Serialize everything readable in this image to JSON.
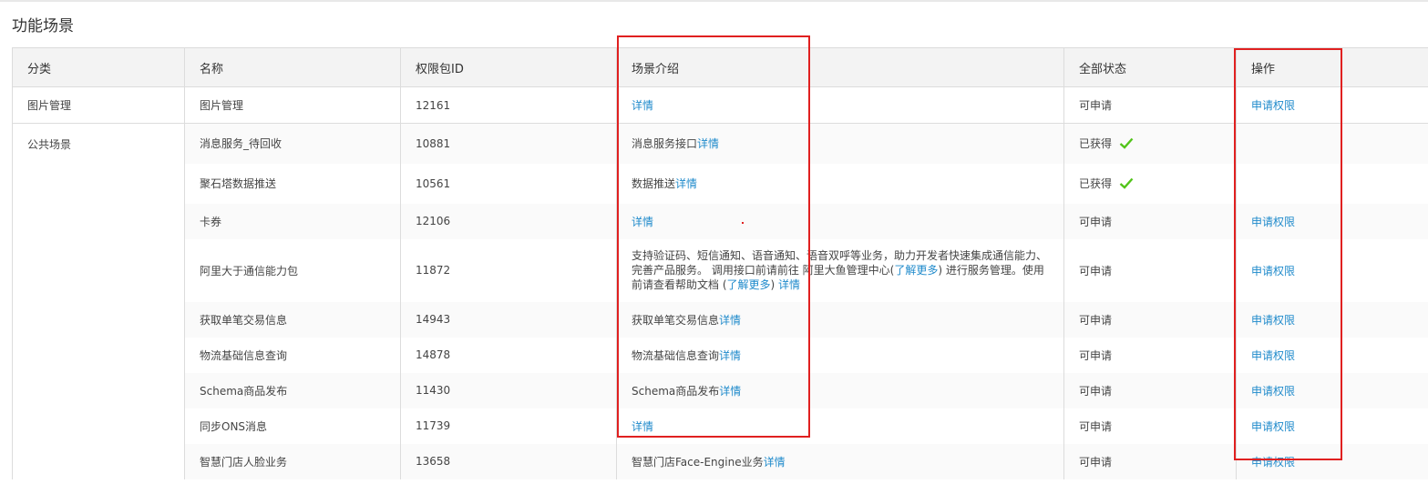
{
  "page": {
    "title": "功能场景"
  },
  "table": {
    "headers": {
      "category": "分类",
      "name": "名称",
      "package_id": "权限包ID",
      "intro": "场景介绍",
      "status": "全部状态",
      "action": "操作"
    },
    "rows": [
      {
        "category": "图片管理",
        "name": "图片管理",
        "id": "12161",
        "intro": "",
        "intro_link": "详情",
        "status": "可申请",
        "action": "申请权限"
      },
      {
        "category": "公共场景",
        "name": "消息服务_待回收",
        "id": "10881",
        "intro": "消息服务接口",
        "intro_link": "详情",
        "status": "已获得",
        "action": ""
      },
      {
        "name": "聚石塔数据推送",
        "id": "10561",
        "intro": "数据推送",
        "intro_link": "详情",
        "status": "已获得",
        "action": ""
      },
      {
        "name": "卡券",
        "id": "12106",
        "intro": "",
        "intro_link": "详情",
        "status": "可申请",
        "action": "申请权限"
      },
      {
        "name": "阿里大于通信能力包",
        "id": "11872",
        "intro_a": "支持验证码、短信通知、语音通知、语音双呼等业务，助力开发者快速集成通信能力、完善产品服务。 调用接口前请前往 阿里大鱼管理中心(",
        "intro_link_a": "了解更多",
        "intro_b": ") 进行服务管理。使用前请查看帮助文档 (",
        "intro_link_b": "了解更多",
        "intro_c": ") ",
        "intro_link": "详情",
        "status": "可申请",
        "action": "申请权限"
      },
      {
        "name": "获取单笔交易信息",
        "id": "14943",
        "intro": "获取单笔交易信息",
        "intro_link": "详情",
        "status": "可申请",
        "action": "申请权限"
      },
      {
        "name": "物流基础信息查询",
        "id": "14878",
        "intro": "物流基础信息查询",
        "intro_link": "详情",
        "status": "可申请",
        "action": "申请权限"
      },
      {
        "name": "Schema商品发布",
        "id": "11430",
        "intro": "Schema商品发布",
        "intro_link": "详情",
        "status": "可申请",
        "action": "申请权限"
      },
      {
        "name": "同步ONS消息",
        "id": "11739",
        "intro": "",
        "intro_link": "详情",
        "status": "可申请",
        "action": "申请权限"
      },
      {
        "name": "智慧门店人脸业务",
        "id": "13658",
        "intro": "智慧门店Face-Engine业务",
        "intro_link": "详情",
        "status": "可申请",
        "action": "申请权限"
      }
    ]
  },
  "icons": {
    "check": "check-icon"
  },
  "colors": {
    "link": "#1f8acb",
    "check": "#52c41a",
    "highlight": "#e02020"
  }
}
